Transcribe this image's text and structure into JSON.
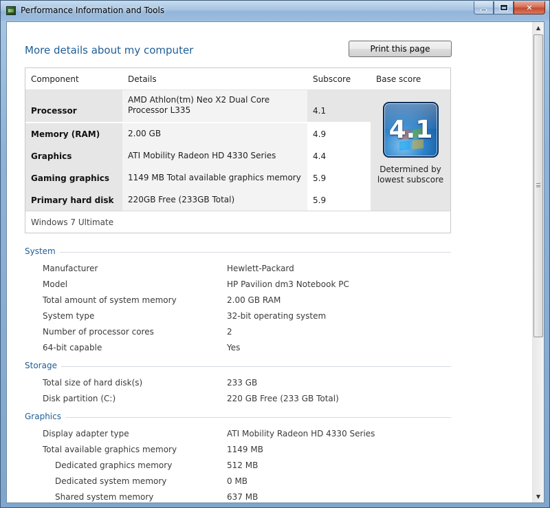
{
  "window": {
    "title": "Performance Information and Tools"
  },
  "page": {
    "title": "More details about my computer",
    "print_label": "Print this page"
  },
  "score_table": {
    "headers": {
      "component": "Component",
      "details": "Details",
      "subscore": "Subscore",
      "base_score": "Base score"
    },
    "rows": [
      {
        "component": "Processor",
        "details": "AMD Athlon(tm) Neo X2 Dual Core Processor L335",
        "subscore": "4.1"
      },
      {
        "component": "Memory (RAM)",
        "details": "2.00 GB",
        "subscore": "4.9"
      },
      {
        "component": "Graphics",
        "details": "ATI Mobility Radeon HD 4330 Series",
        "subscore": "4.4"
      },
      {
        "component": "Gaming graphics",
        "details": "1149 MB Total available graphics memory",
        "subscore": "5.9"
      },
      {
        "component": "Primary hard disk",
        "details": "220GB Free (233GB Total)",
        "subscore": "5.9"
      }
    ],
    "base_score": "4.1",
    "base_caption": "Determined by lowest subscore",
    "os": "Windows 7 Ultimate"
  },
  "system": {
    "title": "System",
    "rows": [
      {
        "key": "Manufacturer",
        "value": "Hewlett-Packard"
      },
      {
        "key": "Model",
        "value": "HP Pavilion dm3 Notebook PC"
      },
      {
        "key": "Total amount of system memory",
        "value": "2.00 GB RAM"
      },
      {
        "key": "System type",
        "value": "32-bit operating system"
      },
      {
        "key": "Number of processor cores",
        "value": "2"
      },
      {
        "key": "64-bit capable",
        "value": "Yes"
      }
    ]
  },
  "storage": {
    "title": "Storage",
    "rows": [
      {
        "key": "Total size of hard disk(s)",
        "value": "233 GB"
      },
      {
        "key": "Disk partition (C:)",
        "value": "220 GB Free (233 GB Total)"
      }
    ]
  },
  "graphics": {
    "title": "Graphics",
    "rows": [
      {
        "key": "Display adapter type",
        "value": "ATI Mobility Radeon HD 4330 Series"
      },
      {
        "key": "Total available graphics memory",
        "value": "1149 MB"
      },
      {
        "key": "Dedicated graphics memory",
        "value": "512 MB"
      },
      {
        "key": "Dedicated system memory",
        "value": "0 MB"
      },
      {
        "key": "Shared system memory",
        "value": "637 MB"
      }
    ]
  },
  "icons": {
    "app": "performance-app-icon",
    "minimize": "minimize-icon",
    "maximize": "maximize-icon",
    "close": "close-icon",
    "badge": "windows-experience-index-badge"
  }
}
